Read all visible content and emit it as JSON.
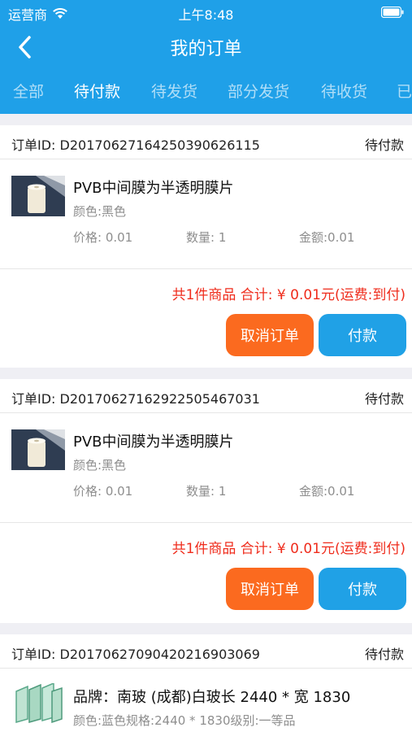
{
  "status_bar": {
    "carrier": "运营商",
    "time": "上午8:48"
  },
  "header": {
    "title": "我的订单"
  },
  "tabs": [
    {
      "label": "全部"
    },
    {
      "label": "待付款"
    },
    {
      "label": "待发货"
    },
    {
      "label": "部分发货"
    },
    {
      "label": "待收货"
    },
    {
      "label": "已"
    }
  ],
  "orders": [
    {
      "id_text": "订单ID: D20170627164250390626115",
      "status": "待付款",
      "item": {
        "name": "PVB中间膜为半透明膜片",
        "color": "颜色:黑色",
        "price": "价格: 0.01",
        "qty": "数量: 1",
        "amount": "金额:0.01"
      },
      "summary": "共1件商品 合计: ¥ 0.01元(运费:到付)",
      "cancel_label": "取消订单",
      "pay_label": "付款"
    },
    {
      "id_text": "订单ID: D20170627162922505467031",
      "status": "待付款",
      "item": {
        "name": "PVB中间膜为半透明膜片",
        "color": "颜色:黑色",
        "price": "价格: 0.01",
        "qty": "数量: 1",
        "amount": "金额:0.01"
      },
      "summary": "共1件商品 合计: ¥ 0.01元(运费:到付)",
      "cancel_label": "取消订单",
      "pay_label": "付款"
    },
    {
      "id_text": "订单ID: D20170627090420216903069",
      "status": "待付款",
      "item": {
        "name": "品牌：南玻 (成都)白玻长 2440 * 宽 1830",
        "color": "颜色:蓝色规格:2440 * 1830级别:一等品"
      }
    }
  ]
}
